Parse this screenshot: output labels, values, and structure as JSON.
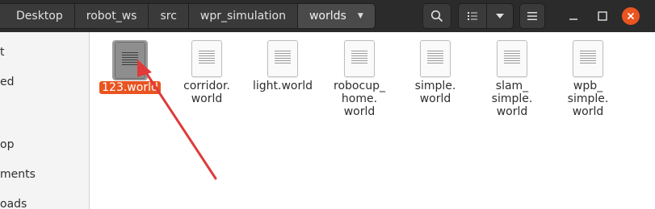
{
  "breadcrumbs": [
    {
      "label": "Desktop"
    },
    {
      "label": "robot_ws"
    },
    {
      "label": "src"
    },
    {
      "label": "wpr_simulation"
    },
    {
      "label": "worlds"
    }
  ],
  "toolbar": {
    "search_icon": "search-icon",
    "view_icon": "list-view-icon",
    "view_menu_icon": "chevron-down-icon",
    "menu_icon": "hamburger-menu-icon"
  },
  "window": {
    "close_color": "#e95420"
  },
  "sidebar": {
    "items": [
      {
        "label": "t"
      },
      {
        "label": "ed"
      },
      {
        "label": "op"
      },
      {
        "label": "ments"
      },
      {
        "label": "oads"
      }
    ]
  },
  "files": [
    {
      "name": "123.world",
      "selected": true
    },
    {
      "name": "corridor.\nworld",
      "selected": false
    },
    {
      "name": "light.world",
      "selected": false
    },
    {
      "name": "robocup_\nhome.\nworld",
      "selected": false
    },
    {
      "name": "simple.\nworld",
      "selected": false
    },
    {
      "name": "slam_\nsimple.\nworld",
      "selected": false
    },
    {
      "name": "wpb_\nsimple.\nworld",
      "selected": false
    }
  ],
  "annotation": {
    "arrow_color": "#e03a3a"
  },
  "colors": {
    "accent": "#e95420",
    "header_bg": "#2b2b2b"
  }
}
